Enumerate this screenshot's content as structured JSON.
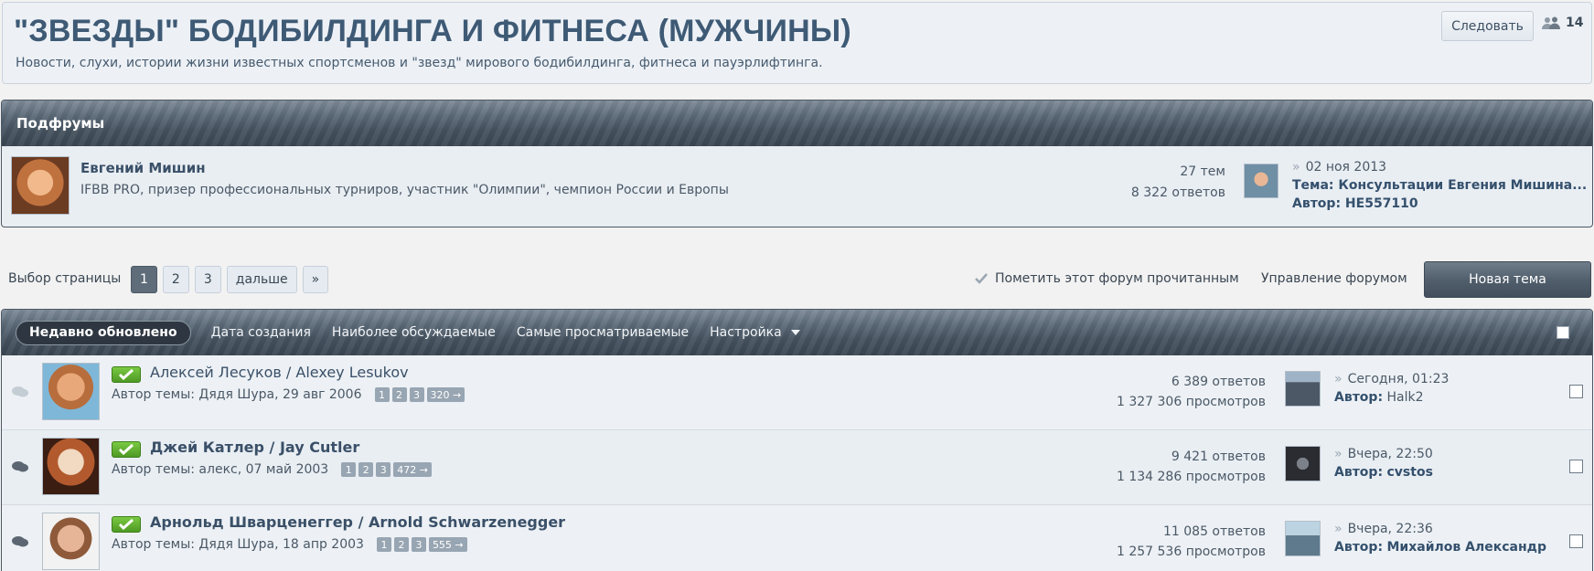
{
  "header": {
    "title": "\"ЗВЕЗДЫ\" БОДИБИЛДИНГА И ФИТНЕСА (МУЖЧИНЫ)",
    "description": "Новости, слухи, истории жизни известных спортсменов и \"звезд\" мирового бодибилдинга, фитнеса и пауэрлифтинга.",
    "follow_label": "Следовать",
    "followers_count": "14",
    "followers_icon": "users-icon"
  },
  "subforums": {
    "heading": "Подфрумы",
    "items": [
      {
        "name": "Евгений Мишин",
        "description": "IFBB PRO, призер профессиональных турниров, участник \"Олимпии\", чемпион России и Европы",
        "threads": "27 тем",
        "replies": "8 322 ответов",
        "last_date": "02 ноя 2013",
        "last_thread": "Тема: Консультации Евгения Мишина...",
        "last_author": "Автор: HE557110"
      }
    ]
  },
  "pagination": {
    "label": "Выбор страницы",
    "pages": [
      "1",
      "2",
      "3"
    ],
    "current": "1",
    "next_label": "дальше",
    "last_label": "»"
  },
  "actions": {
    "mark_read": "Пометить этот форум прочитанным",
    "manage": "Управление форумом",
    "new_topic": "Новая тема"
  },
  "sort": {
    "active": "Недавно обновлено",
    "options": [
      "Дата создания",
      "Наиболее обсуждаемые",
      "Самые просматриваемые"
    ],
    "settings_label": "Настройка"
  },
  "threads": [
    {
      "title": "Алексей Лесуков / Alexey Lesukov",
      "bold": false,
      "meta": "Автор темы: Дядя Шура, 29 авг 2006",
      "pages": [
        "1",
        "2",
        "3",
        "320 →"
      ],
      "replies": "6 389 ответов",
      "views": "1 327 306 просмотров",
      "last_date": "Сегодня, 01:23",
      "last_author_label": "Автор:",
      "last_author": "Halk2"
    },
    {
      "title": "Джей Катлер / Jay Cutler",
      "bold": true,
      "meta": "Автор темы: алекс, 07 май 2003",
      "pages": [
        "1",
        "2",
        "3",
        "472 →"
      ],
      "replies": "9 421 ответов",
      "views": "1 134 286 просмотров",
      "last_date": "Вчера, 22:50",
      "last_author_label": "Автор:",
      "last_author": "cvstos"
    },
    {
      "title": "Арнольд Шварценеггер / Arnold Schwarzenegger",
      "bold": true,
      "meta": "Автор темы: Дядя Шура, 18 апр 2003",
      "pages": [
        "1",
        "2",
        "3",
        "555 →"
      ],
      "replies": "11 085 ответов",
      "views": "1 257 536 просмотров",
      "last_date": "Вчера, 22:36",
      "last_author_label": "Автор:",
      "last_author": "Михайлов Александр"
    }
  ],
  "colors": {
    "accent": "#34506d",
    "panel_header": "#4a5764",
    "new_badge": "#5fae2e"
  }
}
